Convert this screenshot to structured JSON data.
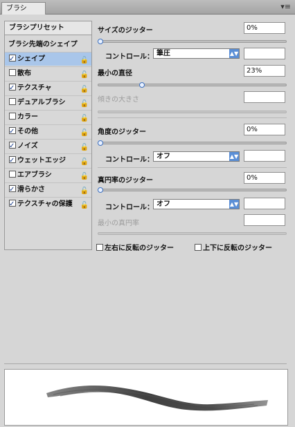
{
  "panel": {
    "tab_label": "ブラシ",
    "menu_icon": "panel-menu-icon"
  },
  "left": {
    "preset_button": "ブラシプリセット",
    "tip_shape_label": "ブラシ先端のシェイプ",
    "options": [
      {
        "label": "シェイプ",
        "checked": true,
        "selected": true
      },
      {
        "label": "散布",
        "checked": false,
        "selected": false
      },
      {
        "label": "テクスチャ",
        "checked": true,
        "selected": false
      },
      {
        "label": "デュアルブラシ",
        "checked": false,
        "selected": false
      },
      {
        "label": "カラー",
        "checked": false,
        "selected": false
      },
      {
        "label": "その他",
        "checked": true,
        "selected": false
      },
      {
        "label": "ノイズ",
        "checked": true,
        "selected": false
      },
      {
        "label": "ウェットエッジ",
        "checked": true,
        "selected": false
      },
      {
        "label": "エアブラシ",
        "checked": false,
        "selected": false
      },
      {
        "label": "滑らかさ",
        "checked": true,
        "selected": false
      },
      {
        "label": "テクスチャの保護",
        "checked": true,
        "selected": false
      }
    ]
  },
  "right": {
    "size_jitter": {
      "label": "サイズのジッター",
      "value": "0%",
      "slider_pct": 0
    },
    "size_control": {
      "label": "コントロール：",
      "value": "筆圧"
    },
    "min_diameter": {
      "label": "最小の直径",
      "value": "23%",
      "slider_pct": 23
    },
    "tilt_scale": {
      "label": "傾きの大きさ"
    },
    "angle_jitter": {
      "label": "角度のジッター",
      "value": "0%",
      "slider_pct": 0
    },
    "angle_control": {
      "label": "コントロール：",
      "value": "オフ"
    },
    "roundness_jitter": {
      "label": "真円率のジッター",
      "value": "0%",
      "slider_pct": 0
    },
    "roundness_control": {
      "label": "コントロール：",
      "value": "オフ"
    },
    "min_roundness": {
      "label": "最小の真円率"
    },
    "flip_x": {
      "label": "左右に反転のジッター",
      "checked": false
    },
    "flip_y": {
      "label": "上下に反転のジッター",
      "checked": false
    }
  }
}
